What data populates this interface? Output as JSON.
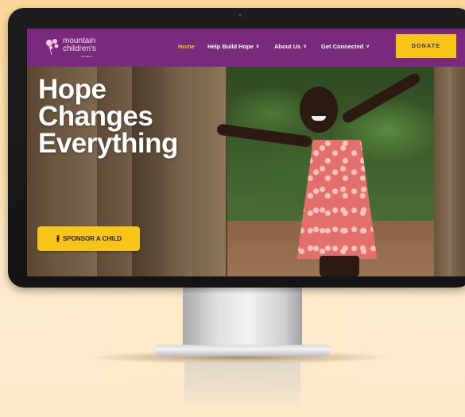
{
  "site": {
    "logo": {
      "line1": "mountain",
      "line2": "children's",
      "line3": "foundation"
    },
    "nav": {
      "items": [
        {
          "label": "Home",
          "active": true,
          "has_dropdown": false
        },
        {
          "label": "Help Build Hope",
          "active": false,
          "has_dropdown": true
        },
        {
          "label": "About Us",
          "active": false,
          "has_dropdown": true
        },
        {
          "label": "Get Connected",
          "active": false,
          "has_dropdown": true
        }
      ],
      "donate_label": "DONATE"
    },
    "hero": {
      "headline_line1": "Hope",
      "headline_line2": "Changes",
      "headline_line3": "Everything",
      "cta_label": "SPONSOR A CHILD"
    }
  },
  "colors": {
    "header_bg": "#7a2a7c",
    "accent": "#f7c518",
    "nav_active": "#f7c518",
    "headline": "#ffffff"
  },
  "icons": {
    "dropdown": "chevron-down-icon",
    "cta": "child-icon",
    "logo": "dandelion-icon"
  }
}
